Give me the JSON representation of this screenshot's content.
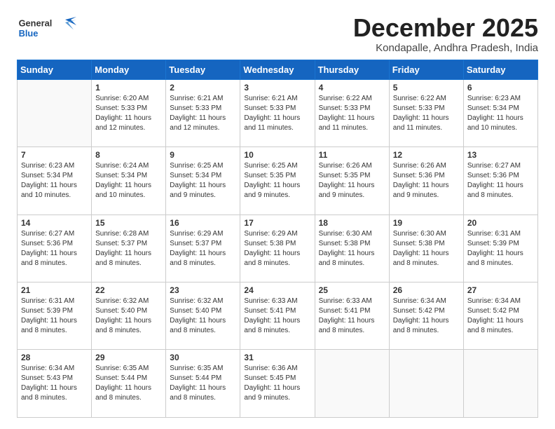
{
  "header": {
    "logo_general": "General",
    "logo_blue": "Blue",
    "month": "December 2025",
    "location": "Kondapalle, Andhra Pradesh, India"
  },
  "days_of_week": [
    "Sunday",
    "Monday",
    "Tuesday",
    "Wednesday",
    "Thursday",
    "Friday",
    "Saturday"
  ],
  "weeks": [
    [
      {
        "day": "",
        "sunrise": "",
        "sunset": "",
        "daylight": ""
      },
      {
        "day": "1",
        "sunrise": "Sunrise: 6:20 AM",
        "sunset": "Sunset: 5:33 PM",
        "daylight": "Daylight: 11 hours and 12 minutes."
      },
      {
        "day": "2",
        "sunrise": "Sunrise: 6:21 AM",
        "sunset": "Sunset: 5:33 PM",
        "daylight": "Daylight: 11 hours and 12 minutes."
      },
      {
        "day": "3",
        "sunrise": "Sunrise: 6:21 AM",
        "sunset": "Sunset: 5:33 PM",
        "daylight": "Daylight: 11 hours and 11 minutes."
      },
      {
        "day": "4",
        "sunrise": "Sunrise: 6:22 AM",
        "sunset": "Sunset: 5:33 PM",
        "daylight": "Daylight: 11 hours and 11 minutes."
      },
      {
        "day": "5",
        "sunrise": "Sunrise: 6:22 AM",
        "sunset": "Sunset: 5:33 PM",
        "daylight": "Daylight: 11 hours and 11 minutes."
      },
      {
        "day": "6",
        "sunrise": "Sunrise: 6:23 AM",
        "sunset": "Sunset: 5:34 PM",
        "daylight": "Daylight: 11 hours and 10 minutes."
      }
    ],
    [
      {
        "day": "7",
        "sunrise": "Sunrise: 6:23 AM",
        "sunset": "Sunset: 5:34 PM",
        "daylight": "Daylight: 11 hours and 10 minutes."
      },
      {
        "day": "8",
        "sunrise": "Sunrise: 6:24 AM",
        "sunset": "Sunset: 5:34 PM",
        "daylight": "Daylight: 11 hours and 10 minutes."
      },
      {
        "day": "9",
        "sunrise": "Sunrise: 6:25 AM",
        "sunset": "Sunset: 5:34 PM",
        "daylight": "Daylight: 11 hours and 9 minutes."
      },
      {
        "day": "10",
        "sunrise": "Sunrise: 6:25 AM",
        "sunset": "Sunset: 5:35 PM",
        "daylight": "Daylight: 11 hours and 9 minutes."
      },
      {
        "day": "11",
        "sunrise": "Sunrise: 6:26 AM",
        "sunset": "Sunset: 5:35 PM",
        "daylight": "Daylight: 11 hours and 9 minutes."
      },
      {
        "day": "12",
        "sunrise": "Sunrise: 6:26 AM",
        "sunset": "Sunset: 5:36 PM",
        "daylight": "Daylight: 11 hours and 9 minutes."
      },
      {
        "day": "13",
        "sunrise": "Sunrise: 6:27 AM",
        "sunset": "Sunset: 5:36 PM",
        "daylight": "Daylight: 11 hours and 8 minutes."
      }
    ],
    [
      {
        "day": "14",
        "sunrise": "Sunrise: 6:27 AM",
        "sunset": "Sunset: 5:36 PM",
        "daylight": "Daylight: 11 hours and 8 minutes."
      },
      {
        "day": "15",
        "sunrise": "Sunrise: 6:28 AM",
        "sunset": "Sunset: 5:37 PM",
        "daylight": "Daylight: 11 hours and 8 minutes."
      },
      {
        "day": "16",
        "sunrise": "Sunrise: 6:29 AM",
        "sunset": "Sunset: 5:37 PM",
        "daylight": "Daylight: 11 hours and 8 minutes."
      },
      {
        "day": "17",
        "sunrise": "Sunrise: 6:29 AM",
        "sunset": "Sunset: 5:38 PM",
        "daylight": "Daylight: 11 hours and 8 minutes."
      },
      {
        "day": "18",
        "sunrise": "Sunrise: 6:30 AM",
        "sunset": "Sunset: 5:38 PM",
        "daylight": "Daylight: 11 hours and 8 minutes."
      },
      {
        "day": "19",
        "sunrise": "Sunrise: 6:30 AM",
        "sunset": "Sunset: 5:38 PM",
        "daylight": "Daylight: 11 hours and 8 minutes."
      },
      {
        "day": "20",
        "sunrise": "Sunrise: 6:31 AM",
        "sunset": "Sunset: 5:39 PM",
        "daylight": "Daylight: 11 hours and 8 minutes."
      }
    ],
    [
      {
        "day": "21",
        "sunrise": "Sunrise: 6:31 AM",
        "sunset": "Sunset: 5:39 PM",
        "daylight": "Daylight: 11 hours and 8 minutes."
      },
      {
        "day": "22",
        "sunrise": "Sunrise: 6:32 AM",
        "sunset": "Sunset: 5:40 PM",
        "daylight": "Daylight: 11 hours and 8 minutes."
      },
      {
        "day": "23",
        "sunrise": "Sunrise: 6:32 AM",
        "sunset": "Sunset: 5:40 PM",
        "daylight": "Daylight: 11 hours and 8 minutes."
      },
      {
        "day": "24",
        "sunrise": "Sunrise: 6:33 AM",
        "sunset": "Sunset: 5:41 PM",
        "daylight": "Daylight: 11 hours and 8 minutes."
      },
      {
        "day": "25",
        "sunrise": "Sunrise: 6:33 AM",
        "sunset": "Sunset: 5:41 PM",
        "daylight": "Daylight: 11 hours and 8 minutes."
      },
      {
        "day": "26",
        "sunrise": "Sunrise: 6:34 AM",
        "sunset": "Sunset: 5:42 PM",
        "daylight": "Daylight: 11 hours and 8 minutes."
      },
      {
        "day": "27",
        "sunrise": "Sunrise: 6:34 AM",
        "sunset": "Sunset: 5:42 PM",
        "daylight": "Daylight: 11 hours and 8 minutes."
      }
    ],
    [
      {
        "day": "28",
        "sunrise": "Sunrise: 6:34 AM",
        "sunset": "Sunset: 5:43 PM",
        "daylight": "Daylight: 11 hours and 8 minutes."
      },
      {
        "day": "29",
        "sunrise": "Sunrise: 6:35 AM",
        "sunset": "Sunset: 5:44 PM",
        "daylight": "Daylight: 11 hours and 8 minutes."
      },
      {
        "day": "30",
        "sunrise": "Sunrise: 6:35 AM",
        "sunset": "Sunset: 5:44 PM",
        "daylight": "Daylight: 11 hours and 8 minutes."
      },
      {
        "day": "31",
        "sunrise": "Sunrise: 6:36 AM",
        "sunset": "Sunset: 5:45 PM",
        "daylight": "Daylight: 11 hours and 9 minutes."
      },
      {
        "day": "",
        "sunrise": "",
        "sunset": "",
        "daylight": ""
      },
      {
        "day": "",
        "sunrise": "",
        "sunset": "",
        "daylight": ""
      },
      {
        "day": "",
        "sunrise": "",
        "sunset": "",
        "daylight": ""
      }
    ]
  ]
}
